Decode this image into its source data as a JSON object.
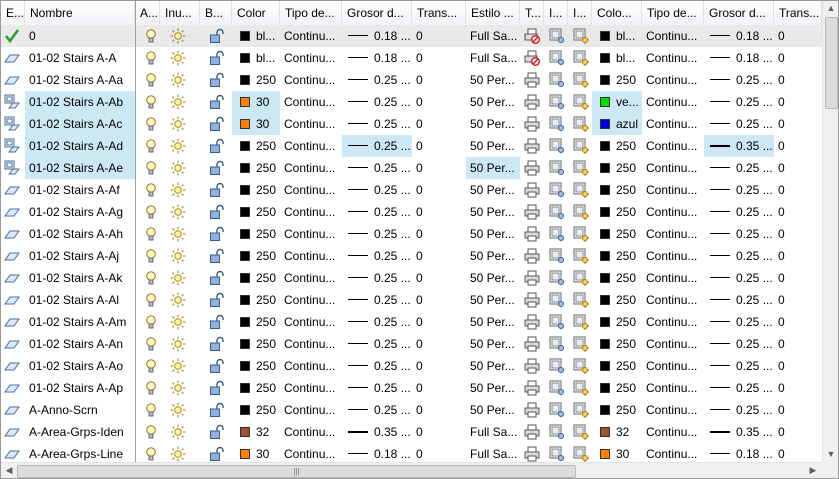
{
  "headers": [
    {
      "key": "estado",
      "label": "E..."
    },
    {
      "key": "nombre",
      "label": "Nombre"
    },
    {
      "key": "activar",
      "label": "A..."
    },
    {
      "key": "inutilizar",
      "label": "Inu..."
    },
    {
      "key": "bloquear",
      "label": "B..."
    },
    {
      "key": "color",
      "label": "Color"
    },
    {
      "key": "tipo",
      "label": "Tipo de..."
    },
    {
      "key": "grosor",
      "label": "Grosor d..."
    },
    {
      "key": "trans",
      "label": "Trans..."
    },
    {
      "key": "estilo",
      "label": "Estilo ..."
    },
    {
      "key": "trazar",
      "label": "T..."
    },
    {
      "key": "i1",
      "label": "I..."
    },
    {
      "key": "i2",
      "label": "I..."
    },
    {
      "key": "vpcolor",
      "label": "Colo..."
    },
    {
      "key": "vptipo",
      "label": "Tipo de..."
    },
    {
      "key": "vpgrosor",
      "label": "Grosor d..."
    },
    {
      "key": "vptrans",
      "label": "Trans..."
    }
  ],
  "icons": {
    "status_current": "checkmark-icon",
    "status_layer": "layer-parallelogram-icon",
    "status_override": "layer-override-icon",
    "on": "lightbulb-icon",
    "freeze": "sun-icon",
    "lock": "open-padlock-icon",
    "plot": "printer-icon",
    "noplot": "no-plot-printer-icon",
    "newvp": "new-viewport-freeze-icon"
  },
  "colors": {
    "black": "#000000",
    "orange": "#ff7f00",
    "brown": "#a0522d",
    "green": "#00e000",
    "blue": "#0000e0",
    "selection": "#cce8f4"
  },
  "rows": [
    {
      "status": "current",
      "name": "0",
      "color_text": "bl...",
      "color_hex": "#000000",
      "linetype": "Continu...",
      "lineweight": "0.18 ...",
      "lw_thick": false,
      "transparency": "0",
      "plotstyle": "Full Sa...",
      "plot": "noplot",
      "vp_color_text": "bl...",
      "vp_color_hex": "#000000",
      "vp_linetype": "Continu...",
      "vp_lineweight": "0.18 ...",
      "vp_lw_thick": false,
      "vp_transparency": "0",
      "row0": true,
      "sel": []
    },
    {
      "status": "layer",
      "name": "01-02 Stairs A-A",
      "color_text": "bl...",
      "color_hex": "#000000",
      "linetype": "Continu...",
      "lineweight": "0.18 ...",
      "lw_thick": false,
      "transparency": "0",
      "plotstyle": "Full Sa...",
      "plot": "noplot",
      "vp_color_text": "bl...",
      "vp_color_hex": "#000000",
      "vp_linetype": "Continu...",
      "vp_lineweight": "0.18 ...",
      "vp_lw_thick": false,
      "vp_transparency": "0",
      "sel": []
    },
    {
      "status": "layer",
      "name": "01-02 Stairs A-Aa",
      "color_text": "250",
      "color_hex": "#000000",
      "linetype": "Continu...",
      "lineweight": "0.25 ...",
      "lw_thick": false,
      "transparency": "0",
      "plotstyle": "50 Per...",
      "plot": "plot",
      "vp_color_text": "250",
      "vp_color_hex": "#000000",
      "vp_linetype": "Continu...",
      "vp_lineweight": "0.25 ...",
      "vp_lw_thick": false,
      "vp_transparency": "0",
      "sel": []
    },
    {
      "status": "override",
      "name": "01-02 Stairs A-Ab",
      "color_text": "30",
      "color_hex": "#ff7f00",
      "linetype": "Continu...",
      "lineweight": "0.25 ...",
      "lw_thick": false,
      "transparency": "0",
      "plotstyle": "50 Per...",
      "plot": "plot",
      "vp_color_text": "ve...",
      "vp_color_hex": "#00e000",
      "vp_linetype": "Continu...",
      "vp_lineweight": "0.25 ...",
      "vp_lw_thick": false,
      "vp_transparency": "0",
      "sel": [
        "nombre",
        "color",
        "vpcolor"
      ]
    },
    {
      "status": "override",
      "name": "01-02 Stairs A-Ac",
      "color_text": "30",
      "color_hex": "#ff7f00",
      "linetype": "Continu...",
      "lineweight": "0.25 ...",
      "lw_thick": false,
      "transparency": "0",
      "plotstyle": "50 Per...",
      "plot": "plot",
      "vp_color_text": "azul",
      "vp_color_hex": "#0000e0",
      "vp_linetype": "Continu...",
      "vp_lineweight": "0.25 ...",
      "vp_lw_thick": false,
      "vp_transparency": "0",
      "sel": [
        "nombre",
        "color",
        "vpcolor"
      ]
    },
    {
      "status": "override",
      "name": "01-02 Stairs A-Ad",
      "color_text": "250",
      "color_hex": "#000000",
      "linetype": "Continu...",
      "lineweight": "0.25 ...",
      "lw_thick": false,
      "transparency": "0",
      "plotstyle": "50 Per...",
      "plot": "plot",
      "vp_color_text": "250",
      "vp_color_hex": "#000000",
      "vp_linetype": "Continu...",
      "vp_lineweight": "0.35 ...",
      "vp_lw_thick": true,
      "vp_transparency": "0",
      "sel": [
        "nombre",
        "grosor",
        "vpgrosor"
      ]
    },
    {
      "status": "override",
      "name": "01-02 Stairs A-Ae",
      "color_text": "250",
      "color_hex": "#000000",
      "linetype": "Continu...",
      "lineweight": "0.25 ...",
      "lw_thick": false,
      "transparency": "0",
      "plotstyle": "50 Per...",
      "plot": "plot",
      "vp_color_text": "250",
      "vp_color_hex": "#000000",
      "vp_linetype": "Continu...",
      "vp_lineweight": "0.25 ...",
      "vp_lw_thick": false,
      "vp_transparency": "0",
      "sel": [
        "nombre",
        "estilo"
      ]
    },
    {
      "status": "layer",
      "name": "01-02 Stairs A-Af",
      "color_text": "250",
      "color_hex": "#000000",
      "linetype": "Continu...",
      "lineweight": "0.25 ...",
      "lw_thick": false,
      "transparency": "0",
      "plotstyle": "50 Per...",
      "plot": "plot",
      "vp_color_text": "250",
      "vp_color_hex": "#000000",
      "vp_linetype": "Continu...",
      "vp_lineweight": "0.25 ...",
      "vp_lw_thick": false,
      "vp_transparency": "0",
      "sel": []
    },
    {
      "status": "layer",
      "name": "01-02 Stairs A-Ag",
      "color_text": "250",
      "color_hex": "#000000",
      "linetype": "Continu...",
      "lineweight": "0.25 ...",
      "lw_thick": false,
      "transparency": "0",
      "plotstyle": "50 Per...",
      "plot": "plot",
      "vp_color_text": "250",
      "vp_color_hex": "#000000",
      "vp_linetype": "Continu...",
      "vp_lineweight": "0.25 ...",
      "vp_lw_thick": false,
      "vp_transparency": "0",
      "sel": []
    },
    {
      "status": "layer",
      "name": "01-02 Stairs A-Ah",
      "color_text": "250",
      "color_hex": "#000000",
      "linetype": "Continu...",
      "lineweight": "0.25 ...",
      "lw_thick": false,
      "transparency": "0",
      "plotstyle": "50 Per...",
      "plot": "plot",
      "vp_color_text": "250",
      "vp_color_hex": "#000000",
      "vp_linetype": "Continu...",
      "vp_lineweight": "0.25 ...",
      "vp_lw_thick": false,
      "vp_transparency": "0",
      "sel": []
    },
    {
      "status": "layer",
      "name": "01-02 Stairs A-Aj",
      "color_text": "250",
      "color_hex": "#000000",
      "linetype": "Continu...",
      "lineweight": "0.25 ...",
      "lw_thick": false,
      "transparency": "0",
      "plotstyle": "50 Per...",
      "plot": "plot",
      "vp_color_text": "250",
      "vp_color_hex": "#000000",
      "vp_linetype": "Continu...",
      "vp_lineweight": "0.25 ...",
      "vp_lw_thick": false,
      "vp_transparency": "0",
      "sel": []
    },
    {
      "status": "layer",
      "name": "01-02 Stairs A-Ak",
      "color_text": "250",
      "color_hex": "#000000",
      "linetype": "Continu...",
      "lineweight": "0.25 ...",
      "lw_thick": false,
      "transparency": "0",
      "plotstyle": "50 Per...",
      "plot": "plot",
      "vp_color_text": "250",
      "vp_color_hex": "#000000",
      "vp_linetype": "Continu...",
      "vp_lineweight": "0.25 ...",
      "vp_lw_thick": false,
      "vp_transparency": "0",
      "sel": []
    },
    {
      "status": "layer",
      "name": "01-02 Stairs A-Al",
      "color_text": "250",
      "color_hex": "#000000",
      "linetype": "Continu...",
      "lineweight": "0.25 ...",
      "lw_thick": false,
      "transparency": "0",
      "plotstyle": "50 Per...",
      "plot": "plot",
      "vp_color_text": "250",
      "vp_color_hex": "#000000",
      "vp_linetype": "Continu...",
      "vp_lineweight": "0.25 ...",
      "vp_lw_thick": false,
      "vp_transparency": "0",
      "sel": []
    },
    {
      "status": "layer",
      "name": "01-02 Stairs A-Am",
      "color_text": "250",
      "color_hex": "#000000",
      "linetype": "Continu...",
      "lineweight": "0.25 ...",
      "lw_thick": false,
      "transparency": "0",
      "plotstyle": "50 Per...",
      "plot": "plot",
      "vp_color_text": "250",
      "vp_color_hex": "#000000",
      "vp_linetype": "Continu...",
      "vp_lineweight": "0.25 ...",
      "vp_lw_thick": false,
      "vp_transparency": "0",
      "sel": []
    },
    {
      "status": "layer",
      "name": "01-02 Stairs A-An",
      "color_text": "250",
      "color_hex": "#000000",
      "linetype": "Continu...",
      "lineweight": "0.25 ...",
      "lw_thick": false,
      "transparency": "0",
      "plotstyle": "50 Per...",
      "plot": "plot",
      "vp_color_text": "250",
      "vp_color_hex": "#000000",
      "vp_linetype": "Continu...",
      "vp_lineweight": "0.25 ...",
      "vp_lw_thick": false,
      "vp_transparency": "0",
      "sel": []
    },
    {
      "status": "layer",
      "name": "01-02 Stairs A-Ao",
      "color_text": "250",
      "color_hex": "#000000",
      "linetype": "Continu...",
      "lineweight": "0.25 ...",
      "lw_thick": false,
      "transparency": "0",
      "plotstyle": "50 Per...",
      "plot": "plot",
      "vp_color_text": "250",
      "vp_color_hex": "#000000",
      "vp_linetype": "Continu...",
      "vp_lineweight": "0.25 ...",
      "vp_lw_thick": false,
      "vp_transparency": "0",
      "sel": []
    },
    {
      "status": "layer",
      "name": "01-02 Stairs A-Ap",
      "color_text": "250",
      "color_hex": "#000000",
      "linetype": "Continu...",
      "lineweight": "0.25 ...",
      "lw_thick": false,
      "transparency": "0",
      "plotstyle": "50 Per...",
      "plot": "plot",
      "vp_color_text": "250",
      "vp_color_hex": "#000000",
      "vp_linetype": "Continu...",
      "vp_lineweight": "0.25 ...",
      "vp_lw_thick": false,
      "vp_transparency": "0",
      "sel": []
    },
    {
      "status": "layer",
      "name": "A-Anno-Scrn",
      "color_text": "250",
      "color_hex": "#000000",
      "linetype": "Continu...",
      "lineweight": "0.25 ...",
      "lw_thick": false,
      "transparency": "0",
      "plotstyle": "50 Per...",
      "plot": "plot",
      "vp_color_text": "250",
      "vp_color_hex": "#000000",
      "vp_linetype": "Continu...",
      "vp_lineweight": "0.25 ...",
      "vp_lw_thick": false,
      "vp_transparency": "0",
      "sel": []
    },
    {
      "status": "layer",
      "name": "A-Area-Grps-Iden",
      "color_text": "32",
      "color_hex": "#a0522d",
      "linetype": "Continu...",
      "lineweight": "0.35 ...",
      "lw_thick": true,
      "transparency": "0",
      "plotstyle": "Full Sa...",
      "plot": "plot",
      "vp_color_text": "32",
      "vp_color_hex": "#a0522d",
      "vp_linetype": "Continu...",
      "vp_lineweight": "0.35 ...",
      "vp_lw_thick": true,
      "vp_transparency": "0",
      "sel": []
    },
    {
      "status": "layer",
      "name": "A-Area-Grps-Line",
      "color_text": "30",
      "color_hex": "#ff7f00",
      "linetype": "Continu...",
      "lineweight": "0.18 ...",
      "lw_thick": false,
      "transparency": "0",
      "plotstyle": "Full Sa...",
      "plot": "plot",
      "vp_color_text": "30",
      "vp_color_hex": "#ff7f00",
      "vp_linetype": "Continu...",
      "vp_lineweight": "0.18 ...",
      "vp_lw_thick": false,
      "vp_transparency": "0",
      "sel": []
    }
  ]
}
